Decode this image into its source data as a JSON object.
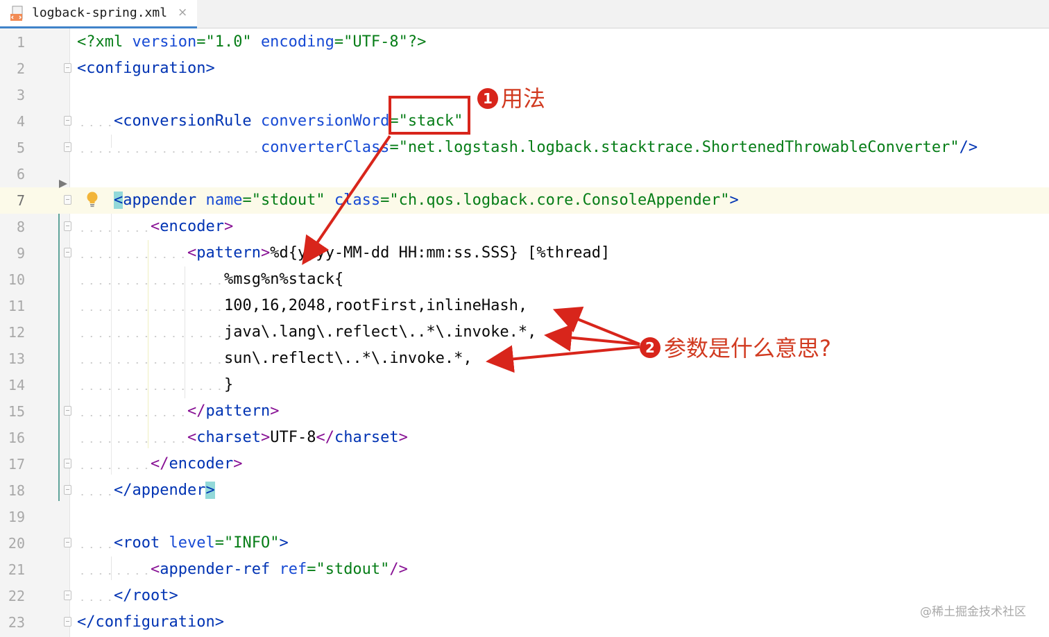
{
  "tab": {
    "filename": "logback-spring.xml",
    "close_glyph": "×",
    "icon": "xml-file-icon"
  },
  "editor": {
    "current_line": 7,
    "lines": [
      {
        "num": "1"
      },
      {
        "num": "2"
      },
      {
        "num": "3"
      },
      {
        "num": "4"
      },
      {
        "num": "5"
      },
      {
        "num": "6"
      },
      {
        "num": "7"
      },
      {
        "num": "8"
      },
      {
        "num": "9"
      },
      {
        "num": "10"
      },
      {
        "num": "11"
      },
      {
        "num": "12"
      },
      {
        "num": "13"
      },
      {
        "num": "14"
      },
      {
        "num": "15"
      },
      {
        "num": "16"
      },
      {
        "num": "17"
      },
      {
        "num": "18"
      },
      {
        "num": "19"
      },
      {
        "num": "20"
      },
      {
        "num": "21"
      },
      {
        "num": "22"
      },
      {
        "num": "23"
      }
    ],
    "code": {
      "l1": {
        "open": "<?xml",
        "a1": "version",
        "eq1": "=",
        "v1": "\"1.0\"",
        "a2": "encoding",
        "eq2": "=",
        "v2": "\"UTF-8\"",
        "close": "?>"
      },
      "l2": {
        "lt": "<",
        "tag": "configuration",
        "gt": ">"
      },
      "l4": {
        "lt": "<",
        "tag": "conversionRule",
        "attr": "conversionWord",
        "eq": "=",
        "val": "\"stack\""
      },
      "l5": {
        "attr": "converterClass",
        "eq": "=",
        "val": "\"net.logstash.logback.stacktrace.ShortenedThrowableConverter\"",
        "close": "/>"
      },
      "l7": {
        "lt": "<",
        "tag": "appender",
        "a1": "name",
        "eq1": "=",
        "v1": "\"stdout\"",
        "a2": "class",
        "eq2": "=",
        "v2": "\"ch.qos.logback.core.ConsoleAppender\"",
        "gt": ">"
      },
      "l8": {
        "lt": "<",
        "tag": "encoder",
        "gt": ">"
      },
      "l9": {
        "lt": "<",
        "tag": "pattern",
        "gt": ">",
        "text": "%d{yyyy-MM-dd HH:mm:ss.SSS} [%thread]"
      },
      "l10": {
        "text": "%msg%n%stack{"
      },
      "l11": {
        "text": "100,16,2048,rootFirst,inlineHash,"
      },
      "l12": {
        "text": "java\\.lang\\.reflect\\..*\\.invoke.*,"
      },
      "l13": {
        "text": "sun\\.reflect\\..*\\.invoke.*,"
      },
      "l14": {
        "text": "}"
      },
      "l15": {
        "lt": "</",
        "tag": "pattern",
        "gt": ">"
      },
      "l16": {
        "lt": "<",
        "tag": "charset",
        "gt": ">",
        "text": "UTF-8",
        "lt2": "</",
        "tag2": "charset",
        "gt2": ">"
      },
      "l17": {
        "lt": "</",
        "tag": "encoder",
        "gt": ">"
      },
      "l18": {
        "lt": "</",
        "tag": "appender",
        "gt": ">"
      },
      "l20": {
        "lt": "<",
        "tag": "root",
        "attr": "level",
        "eq": "=",
        "val": "\"INFO\"",
        "gt": ">"
      },
      "l21": {
        "lt": "<",
        "tag": "appender-ref",
        "attr": "ref",
        "eq": "=",
        "val": "\"stdout\"",
        "close": "/>"
      },
      "l22": {
        "lt": "</",
        "tag": "root",
        "gt": ">"
      },
      "l23": {
        "lt": "</",
        "tag": "configuration",
        "gt": ">"
      }
    }
  },
  "annotations": {
    "a1": {
      "badge": "1",
      "label": "用法"
    },
    "a2": {
      "badge": "2",
      "label": "参数是什么意思?"
    },
    "color": "#d8251b"
  },
  "watermark": "@稀土掘金技术社区",
  "colors": {
    "tag": "#0033b3",
    "attr": "#174ad4",
    "value": "#067d17",
    "pattern_tag": "#871094",
    "current_line_bg": "#fcfae9",
    "tab_underline": "#4083c9"
  }
}
